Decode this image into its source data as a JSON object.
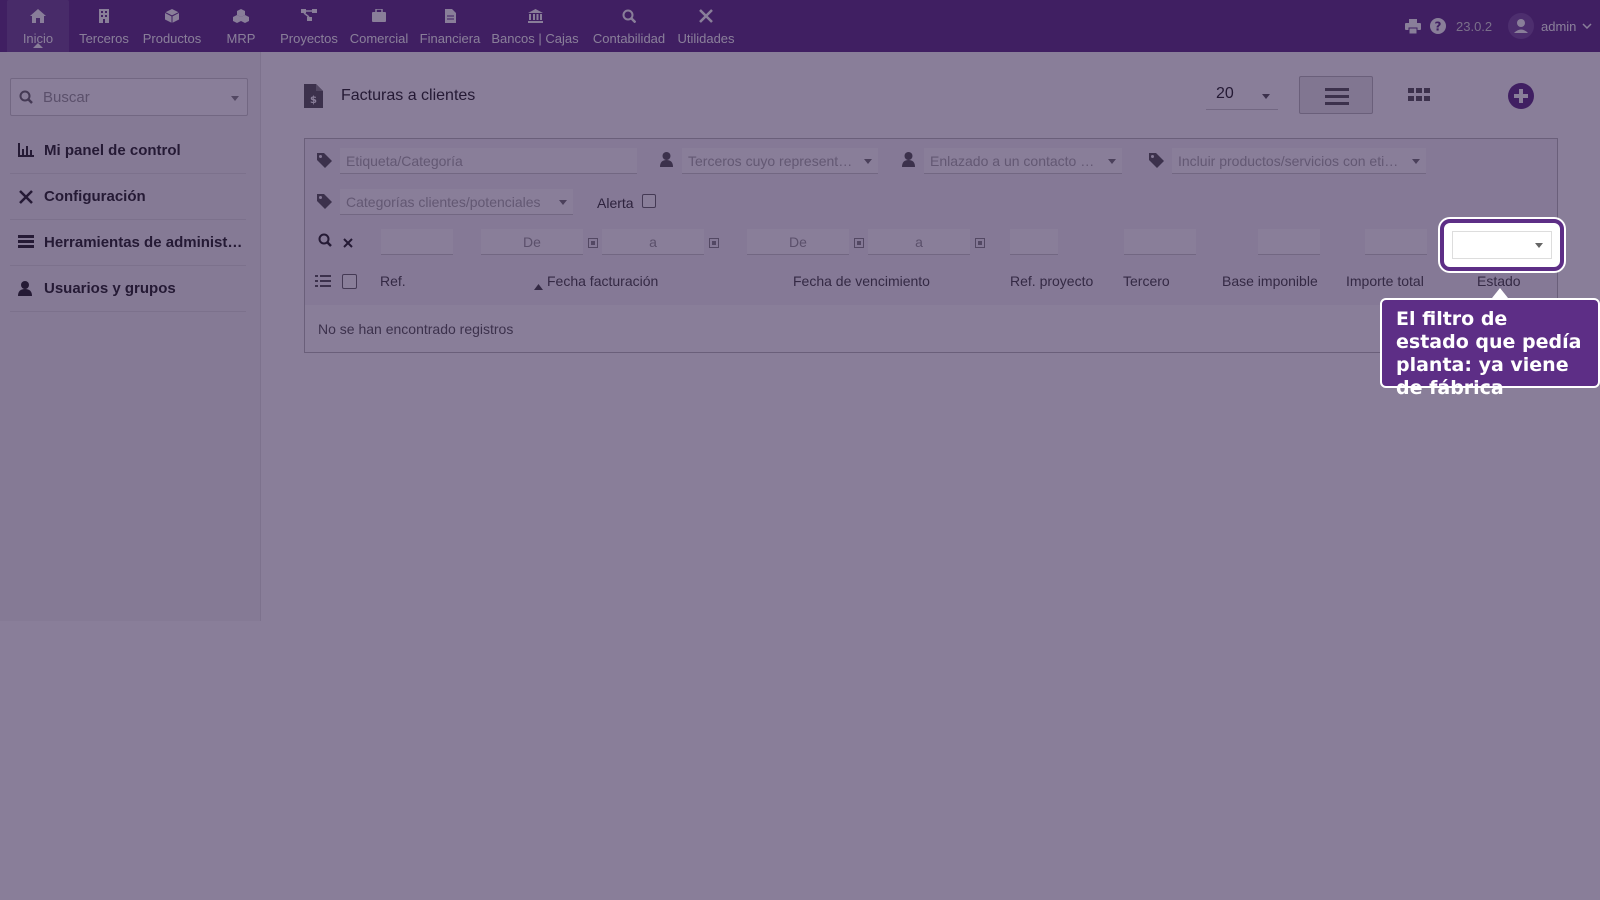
{
  "nav": {
    "items": [
      {
        "label": "Inicio",
        "icon": "home-icon",
        "active": true
      },
      {
        "label": "Terceros",
        "icon": "building-icon"
      },
      {
        "label": "Productos",
        "icon": "cube-icon"
      },
      {
        "label": "MRP",
        "icon": "cubes-icon"
      },
      {
        "label": "Proyectos",
        "icon": "project-diagram-icon"
      },
      {
        "label": "Comercial",
        "icon": "suitcase-icon"
      },
      {
        "label": "Financiera",
        "icon": "file-invoice-icon"
      },
      {
        "label": "Bancos | Cajas",
        "icon": "bank-icon"
      },
      {
        "label": "Contabilidad",
        "icon": "search-dollar-icon"
      },
      {
        "label": "Utilidades",
        "icon": "tools-icon"
      }
    ],
    "version": "23.0.2",
    "user": "admin"
  },
  "sidebar": {
    "search_placeholder": "Buscar",
    "items": [
      {
        "label": "Mi panel de control",
        "icon": "chart-icon"
      },
      {
        "label": "Configuración",
        "icon": "tools-icon"
      },
      {
        "label": "Herramientas de administración",
        "icon": "server-icon"
      },
      {
        "label": "Usuarios y grupos",
        "icon": "user-icon"
      }
    ]
  },
  "main": {
    "title": "Facturas a clientes",
    "limit": "20",
    "filters": {
      "tag": "Etiqueta/Categoría",
      "sales_rep": "Terceros cuyo representante es",
      "contact": "Enlazado a un contacto de usuario",
      "products": "Incluir productos/servicios con etiqueta",
      "customer_categories": "Categorías clientes/potenciales",
      "alert": "Alerta",
      "date_from": "De",
      "date_to": "a"
    },
    "columns": {
      "ref": "Ref.",
      "invoice_date": "Fecha facturación",
      "due_date": "Fecha de vencimiento",
      "project_ref": "Ref. proyecto",
      "thirdparty": "Tercero",
      "base": "Base imponible",
      "total": "Importe total",
      "status": "Estado"
    },
    "empty": "No se han encontrado registros"
  },
  "callout": {
    "text": "El filtro de estado que pedía planta: ya viene de fábrica"
  },
  "colors": {
    "brand": "#5d2e86",
    "overlay": "#281446"
  }
}
